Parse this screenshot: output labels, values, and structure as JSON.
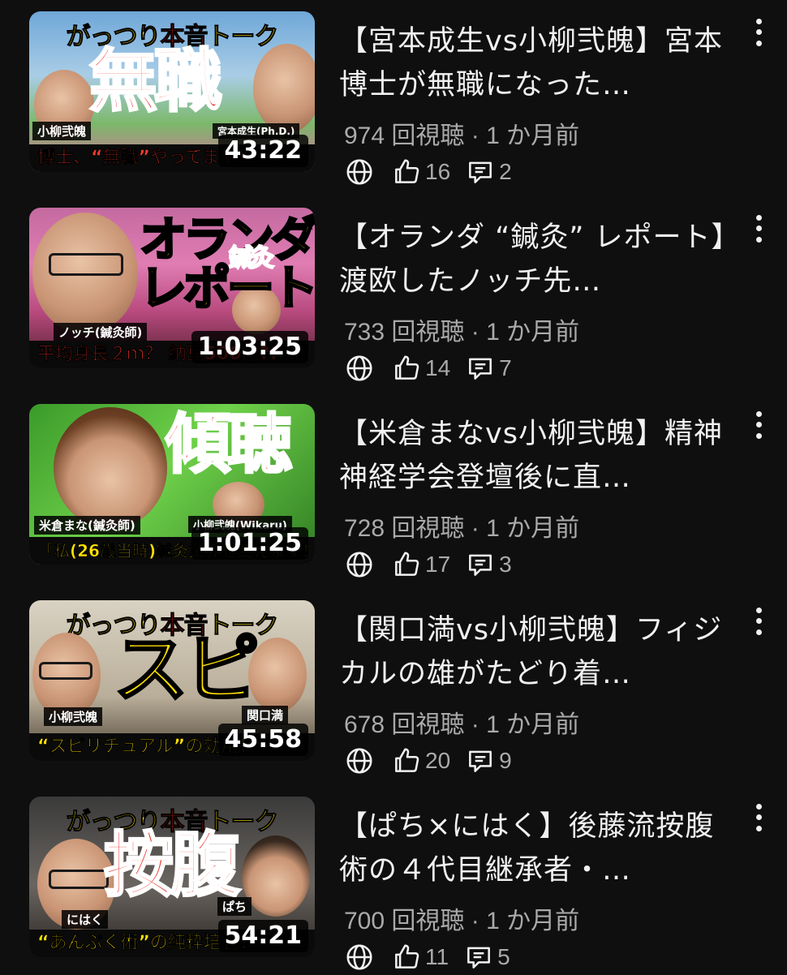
{
  "colors": {
    "background": "#0f0f0f",
    "title": "#f1f1f1",
    "meta": "#aaaaaa",
    "accent_red": "#e8251c",
    "accent_yellow": "#ffe100"
  },
  "videos": [
    {
      "title": "【宮本成生vs小柳弐魄】宮本博士が無職になった…",
      "views": "974 回視聴",
      "age": "1 か月前",
      "likes": "16",
      "comments": "2",
      "duration": "43:22",
      "thumb": {
        "banner_yellow": "がっつり",
        "banner_red": "本音",
        "banner_yellow2": "トーク",
        "big": "無職",
        "tag_left": "小柳弐魄",
        "tag_right": "宮本成生(Ph.D.)",
        "caption": "博士、“無職”やってます！"
      }
    },
    {
      "title": "【オランダ “鍼灸” レポート】渡欧したノッチ先…",
      "views": "733 回視聴",
      "age": "1 か月前",
      "likes": "14",
      "comments": "7",
      "duration": "1:03:25",
      "thumb": {
        "big": "オランダ",
        "big2": "レポート",
        "small": "鍼灸",
        "tag_left": "ノッチ(鍼灸師)",
        "caption": "平均身長２ｍ？ 納豆500円?!"
      }
    },
    {
      "title": "【米倉まなvs小柳弐魄】精神神経学会登壇後に直…",
      "views": "728 回視聴",
      "age": "1 か月前",
      "likes": "17",
      "comments": "3",
      "duration": "1:01:25",
      "thumb": {
        "big": "傾聴",
        "tag_left": "米倉まな(鍼灸師)",
        "tag_right": "小柳弐魄(Wikaru)",
        "caption": "「私(26歳当時)鍼灸業界を変えます！"
      }
    },
    {
      "title": "【関口満vs小柳弐魄】フィジカルの雄がたどり着…",
      "views": "678 回視聴",
      "age": "1 か月前",
      "likes": "20",
      "comments": "9",
      "duration": "45:58",
      "thumb": {
        "banner_yellow": "がっつり",
        "banner_red": "本音",
        "banner_yellow2": "トーク",
        "big": "スピ",
        "tag_left": "小柳弐魄",
        "tag_right": "関口満",
        "caption": "“スピリチュアル”の効用！"
      }
    },
    {
      "title": "【ぱち×にはく】後藤流按腹術の４代目継承者・…",
      "views": "700 回視聴",
      "age": "1 か月前",
      "likes": "11",
      "comments": "5",
      "duration": "54:21",
      "thumb": {
        "banner_yellow": "がっつり",
        "banner_red": "本音",
        "banner_yellow2": "トーク",
        "big": "按腹",
        "tag_left": "にはく",
        "tag_right": "ぱち",
        "caption": "“あんぷく術”の純粋培養！"
      }
    }
  ]
}
